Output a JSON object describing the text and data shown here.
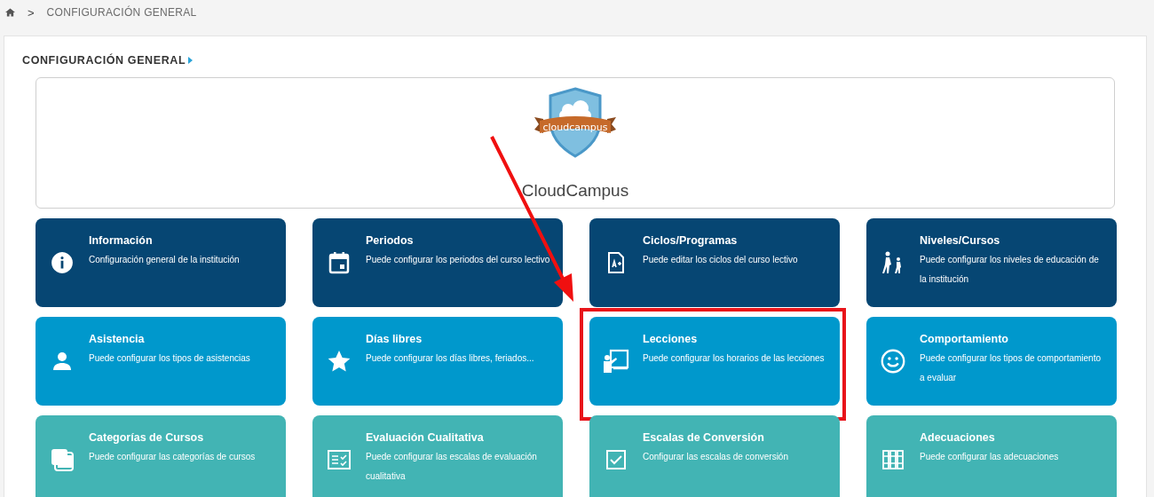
{
  "breadcrumb": {
    "separator": ">",
    "current": "CONFIGURACIÓN GENERAL"
  },
  "section_title": "CONFIGURACIÓN GENERAL",
  "logo": {
    "badge_text": "cloudcampus",
    "name": "CloudCampus"
  },
  "cards": [
    {
      "title": "Información",
      "description": "Configuración general de la institución",
      "color": "#064673",
      "highlighted": false
    },
    {
      "title": "Periodos",
      "description": "Puede configurar los periodos del curso lectivo",
      "color": "#064673",
      "highlighted": false
    },
    {
      "title": "Ciclos/Programas",
      "description": "Puede editar los ciclos del curso lectivo",
      "color": "#064673",
      "highlighted": false
    },
    {
      "title": "Niveles/Cursos",
      "description": "Puede configurar los niveles de educación de la institución",
      "color": "#064673",
      "highlighted": false
    },
    {
      "title": "Asistencia",
      "description": "Puede configurar los tipos de asistencias",
      "color": "#0098cc",
      "highlighted": false
    },
    {
      "title": "Días libres",
      "description": "Puede configurar los días libres, feriados...",
      "color": "#0098cc",
      "highlighted": false
    },
    {
      "title": "Lecciones",
      "description": "Puede configurar los horarios de las lecciones",
      "color": "#0098cc",
      "highlighted": true
    },
    {
      "title": "Comportamiento",
      "description": "Puede configurar los tipos de comportamiento a evaluar",
      "color": "#0098cc",
      "highlighted": false
    },
    {
      "title": "Categorías de Cursos",
      "description": "Puede configurar las categorías de cursos",
      "color": "#42b4b4",
      "highlighted": false
    },
    {
      "title": "Evaluación Cualitativa",
      "description": "Puede configurar las escalas de evaluación cualitativa",
      "color": "#42b4b4",
      "highlighted": false
    },
    {
      "title": "Escalas de Conversión",
      "description": "Configurar las escalas de conversión",
      "color": "#42b4b4",
      "highlighted": false
    },
    {
      "title": "Adecuaciones",
      "description": "Puede configurar las adecuaciones",
      "color": "#42b4b4",
      "highlighted": false
    }
  ]
}
